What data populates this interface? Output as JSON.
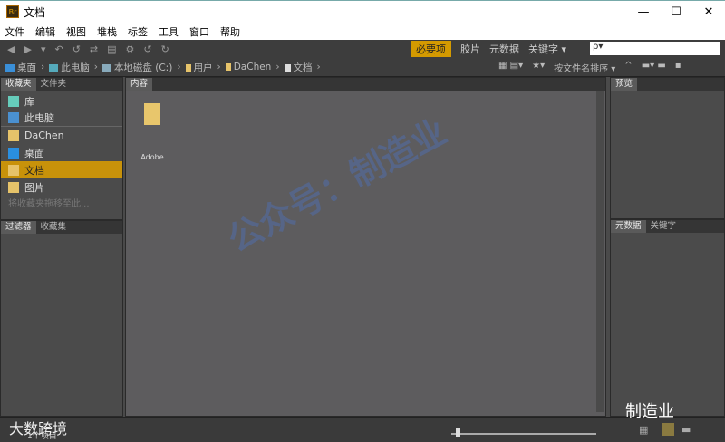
{
  "window": {
    "title": "文档",
    "app_icon": "Br",
    "controls": [
      "—",
      "☐",
      "✕"
    ]
  },
  "menu": [
    "文件",
    "编辑",
    "视图",
    "堆栈",
    "标签",
    "工具",
    "窗口",
    "帮助"
  ],
  "workspaces": {
    "items": [
      "必要项",
      "胶片",
      "元数据",
      "关键字 ▾"
    ],
    "active": "必要项",
    "accent": "#d49a00"
  },
  "search": {
    "placeholder": "ρ▾"
  },
  "path": [
    "桌面",
    "此电脑",
    "本地磁盘 (C:)",
    "用户",
    "DaChen",
    "文档"
  ],
  "sort": {
    "label": "按文件名排序 ▾"
  },
  "left_top": {
    "tabs": [
      "收藏夹",
      "文件夹"
    ],
    "items": [
      "库",
      "此电脑",
      "DaChen",
      "桌面",
      "文档",
      "图片"
    ],
    "selected": "文档",
    "hint": "将收藏夹拖移至此..."
  },
  "left_bottom": {
    "tabs": [
      "过滤器",
      "收藏集"
    ]
  },
  "content": {
    "tab": "内容",
    "items": [
      {
        "name": "Adobe"
      }
    ]
  },
  "right_top": {
    "tab": "预览"
  },
  "right_bottom": {
    "tabs": [
      "元数据",
      "关键字"
    ]
  },
  "status": {
    "text": "1个项目"
  },
  "watermarks": {
    "center": "公众号：制造业",
    "bottom_left": "大数跨境",
    "bottom_right": "制造业"
  }
}
